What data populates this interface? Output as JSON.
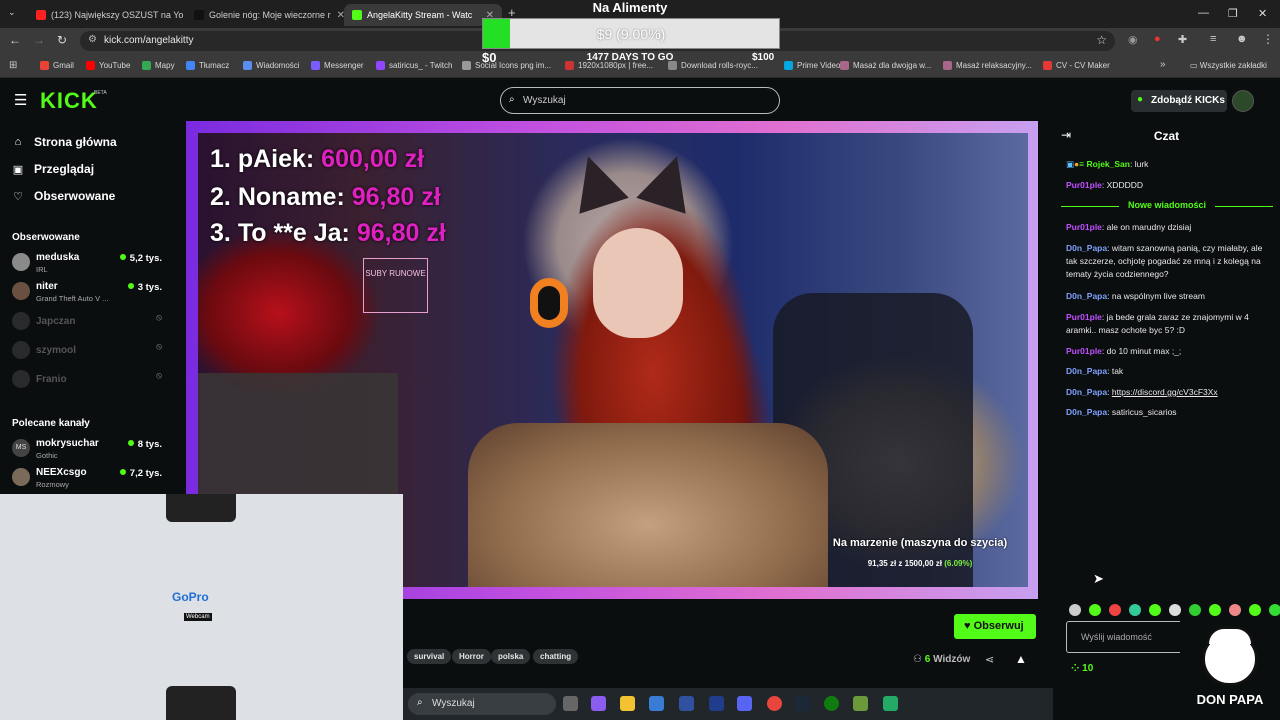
{
  "browser": {
    "tabs": [
      {
        "title": "(123) Największy OSZUST na Yo",
        "color": "#ff2020"
      },
      {
        "title": "Golenie nóg: Moje wieczorne r",
        "color": "#111111"
      },
      {
        "title": "AngelaKitty Stream - Watc",
        "color": "#53fc18"
      }
    ],
    "new_tab": "+",
    "url": "kick.com/angelakitty",
    "bookmarks": [
      {
        "label": "Gmail",
        "color": "#ea4335"
      },
      {
        "label": "YouTube",
        "color": "#ff0000"
      },
      {
        "label": "Mapy",
        "color": "#34a853"
      },
      {
        "label": "Tłumacz",
        "color": "#4285f4"
      },
      {
        "label": "Wiadomości",
        "color": "#5b8def"
      },
      {
        "label": "Messenger",
        "color": "#7b5cff"
      },
      {
        "label": "satiricus_ - Twitch",
        "color": "#9146ff"
      },
      {
        "label": "Social Icons png im...",
        "color": "#999999"
      },
      {
        "label": "1920x1080px | free...",
        "color": "#cc3333"
      },
      {
        "label": "Download rolls-royc...",
        "color": "#888888"
      },
      {
        "label": "Prime Video",
        "color": "#00a8e1"
      },
      {
        "label": "Masaż dla dwojga w...",
        "color": "#aa6688"
      },
      {
        "label": "Masaż relaksacyjny...",
        "color": "#aa6688"
      },
      {
        "label": "CV - CV Maker",
        "color": "#e53935"
      }
    ],
    "all_bookmarks": "Wszystkie zakładki"
  },
  "overlay_goal": {
    "title": "Na Alimenty",
    "progress_text": "$9 (9.00%)",
    "progress_fraction": 0.09,
    "start": "$0",
    "days": "1477 DAYS TO GO",
    "end": "$100"
  },
  "kick": {
    "logo": "KICK",
    "beta": "BETA",
    "search_placeholder": "Wyszukaj",
    "get_kicks": "Zdobądź KICKs",
    "accent": "#53fc18"
  },
  "sidebar": {
    "nav": [
      {
        "label": "Strona główna",
        "icon": "home-icon"
      },
      {
        "label": "Przeglądaj",
        "icon": "browse-icon"
      },
      {
        "label": "Obserwowane",
        "icon": "heart-icon"
      }
    ],
    "followed_title": "Obserwowane",
    "followed": [
      {
        "name": "meduska",
        "game": "IRL",
        "viewers": "5,2 tys.",
        "live": true
      },
      {
        "name": "niter",
        "game": "Grand Theft Auto V ...",
        "viewers": "3 tys.",
        "live": true
      },
      {
        "name": "Japczan",
        "game": "",
        "viewers": "",
        "live": false
      },
      {
        "name": "szymool",
        "game": "",
        "viewers": "",
        "live": false
      },
      {
        "name": "Franio",
        "game": "",
        "viewers": "",
        "live": false
      }
    ],
    "recommended_title": "Polecane kanały",
    "recommended": [
      {
        "name": "mokrysuchar",
        "game": "Gothic",
        "viewers": "8 tys.",
        "live": true,
        "avatar_text": "MS"
      },
      {
        "name": "NEEXcsgo",
        "game": "Rozmowy",
        "viewers": "7,2 tys.",
        "live": true,
        "avatar_text": ""
      }
    ]
  },
  "video": {
    "leaderboard": [
      {
        "rank": "1.",
        "name": "pAiek:",
        "amount": "600,00 zł"
      },
      {
        "rank": "2.",
        "name": "Noname:",
        "amount": "96,80 zł"
      },
      {
        "rank": "3.",
        "name": "To **e Ja:",
        "amount": "96,80 zł"
      }
    ],
    "sign": "SUBY RUNOWE",
    "goal_label": "Na marzenie (maszyna do szycia)",
    "goal_current": "91,35 zł",
    "goal_separator": "z",
    "goal_target": "1500,00 zł",
    "goal_percent": "(6.09%)"
  },
  "gopro": {
    "logo": "GoPro",
    "sub": "Webcam"
  },
  "stream": {
    "follow_label": "Obserwuj",
    "tags": [
      "survival",
      "Horror",
      "polska",
      "chatting"
    ],
    "viewers_count": "6",
    "viewers_label": "Widzów"
  },
  "taskbar": {
    "search": "Wyszukaj"
  },
  "chat": {
    "title": "Czat",
    "messages_before": [
      {
        "user": "Rojek_San",
        "text": "lurk",
        "color": "#53fc18"
      },
      {
        "user": "Pur01ple",
        "text": "XDDDDD",
        "color": "#c050ff"
      }
    ],
    "new_messages_label": "Nowe wiadomości",
    "messages_after": [
      {
        "user": "Pur01ple",
        "text": "ale on marudny dzisiaj",
        "color": "#c050ff"
      },
      {
        "user": "D0n_Papa",
        "text": "witam szanowną panią, czy miałaby, ale tak szczerze, ochjotę pogadać ze mną i z kolegą na tematy życia codziennego?",
        "color": "#7fa0ff"
      },
      {
        "user": "D0n_Papa",
        "text": "na wspólnym live stream",
        "color": "#7fa0ff"
      },
      {
        "user": "Pur01ple",
        "text": "ja bede grala zaraz ze znajomymi w 4 aramki.. masz ochote byc 5? :D",
        "color": "#c050ff"
      },
      {
        "user": "Pur01ple",
        "text": "do 10 minut max ;_;",
        "color": "#c050ff"
      },
      {
        "user": "D0n_Papa",
        "text": "tak",
        "color": "#7fa0ff"
      },
      {
        "user": "D0n_Papa",
        "text": "https://discord.gg/cV3cF3Xx",
        "color": "#7fa0ff"
      },
      {
        "user": "D0n_Papa",
        "text": "satiricus_sicarios",
        "color": "#7fa0ff"
      }
    ],
    "input_placeholder": "Wyślij wiadomość",
    "points": "10"
  },
  "donpapa": {
    "label": "DON PAPA"
  }
}
